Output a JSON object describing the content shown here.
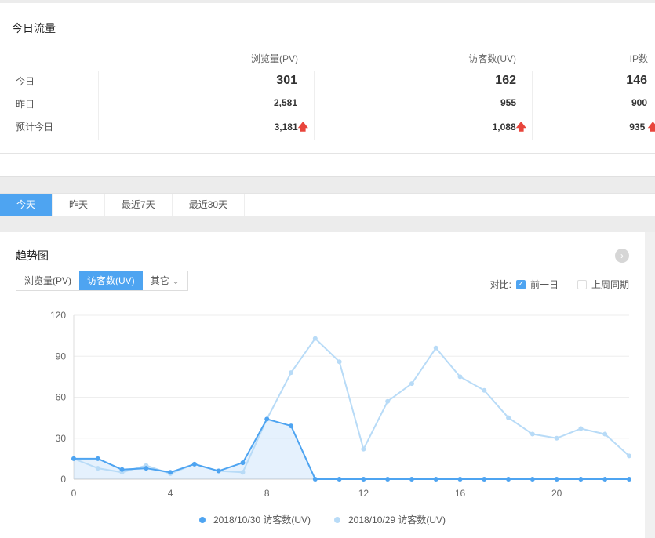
{
  "traffic": {
    "title": "今日流量",
    "columns": [
      "浏览量(PV)",
      "访客数(UV)",
      "IP数"
    ],
    "rows": [
      {
        "label": "今日",
        "values": [
          "301",
          "162",
          "146"
        ]
      },
      {
        "label": "昨日",
        "values": [
          "2,581",
          "955",
          "900"
        ]
      },
      {
        "label": "预计今日",
        "values": [
          "3,181",
          "1,088",
          "935"
        ],
        "trend": "up"
      }
    ]
  },
  "tabs": [
    "今天",
    "昨天",
    "最近7天",
    "最近30天"
  ],
  "trend": {
    "title": "趋势图",
    "segments": [
      "浏览量(PV)",
      "访客数(UV)",
      "其它"
    ],
    "compare_label": "对比:",
    "compare_options": [
      {
        "label": "前一日",
        "checked": true
      },
      {
        "label": "上周同期",
        "checked": false
      }
    ]
  },
  "colors": {
    "accent": "#4ea4f1",
    "series_today": "#4ea4f1",
    "series_prev": "#b8dbf7",
    "up": "#e8453c"
  },
  "chart_data": {
    "type": "line",
    "x": [
      0,
      1,
      2,
      3,
      4,
      5,
      6,
      7,
      8,
      9,
      10,
      11,
      12,
      13,
      14,
      15,
      16,
      17,
      18,
      19,
      20,
      21,
      22,
      23
    ],
    "xticks": [
      "0",
      "4",
      "8",
      "12",
      "16",
      "20"
    ],
    "yticks": [
      "0",
      "30",
      "60",
      "90",
      "120"
    ],
    "ylim": [
      0,
      120
    ],
    "legend": "bottom",
    "series": [
      {
        "name": "2018/10/30 访客数(UV)",
        "values": [
          15,
          15,
          7,
          8,
          5,
          11,
          6,
          12,
          44,
          39,
          0,
          0,
          0,
          0,
          0,
          0,
          0,
          0,
          0,
          0,
          0,
          0,
          0,
          0
        ]
      },
      {
        "name": "2018/10/29 访客数(UV)",
        "values": [
          15,
          8,
          5,
          10,
          4,
          11,
          6,
          5,
          44,
          78,
          103,
          86,
          22,
          57,
          70,
          96,
          75,
          65,
          45,
          33,
          30,
          37,
          33,
          17
        ]
      }
    ]
  }
}
